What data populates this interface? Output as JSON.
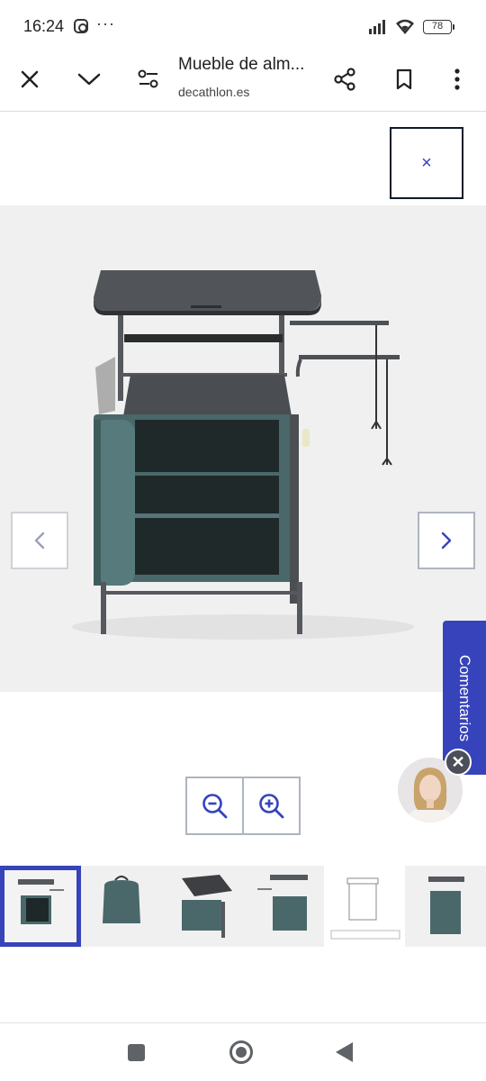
{
  "status_bar": {
    "time": "16:24",
    "more_indicator": "···",
    "battery": "78",
    "icons": [
      "instagram-icon",
      "signal-icon",
      "wifi-icon",
      "battery-icon"
    ]
  },
  "toolbar": {
    "title": "Mueble de alm...",
    "url": "decathlon.es",
    "icons": [
      "close-icon",
      "chevron-down-icon",
      "page-settings-icon",
      "share-icon",
      "bookmark-icon",
      "more-vert-icon"
    ]
  },
  "viewer": {
    "close_glyph": "×",
    "product_alt": "Mueble de almacenamiento de camping con mesa, gris y verde",
    "zoom_icons": [
      "zoom-out-icon",
      "zoom-in-icon"
    ],
    "thumbnail_count": 6,
    "active_thumbnail": 1
  },
  "feedback": {
    "label": "Comentarios",
    "close_glyph": "✕"
  },
  "colors": {
    "accent": "#3643ba",
    "image_background": "#f0f0f0",
    "cabinet_green": "#4a6869",
    "table_top": "#4e5157"
  }
}
